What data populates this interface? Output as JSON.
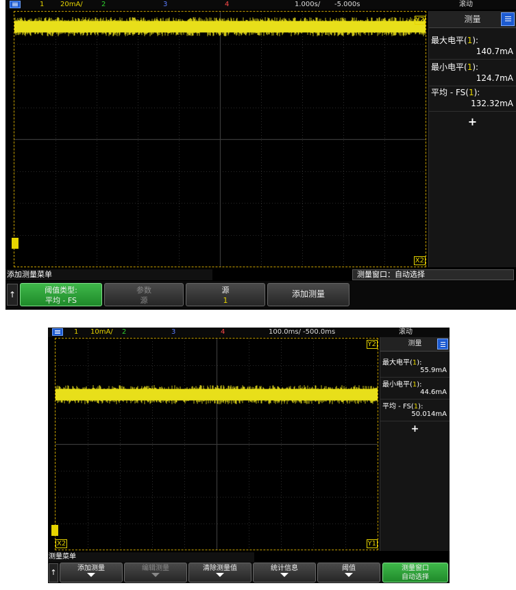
{
  "screen1": {
    "topbar": {
      "ch1": "1",
      "ch1_scale": "20mA/",
      "ch2": "2",
      "ch3": "3",
      "ch4": "4",
      "timebase": "1.000s/",
      "delay": "-5.000s",
      "mode": "滚动"
    },
    "markers": {
      "y2": "Y2",
      "x2": "X2"
    },
    "panel": {
      "title": "测量",
      "measurements": [
        {
          "name": "最大电平",
          "ch": "1",
          "value": "140.7mA"
        },
        {
          "name": "最小电平",
          "ch": "1",
          "value": "124.7mA"
        },
        {
          "name": "平均 - FS",
          "ch": "1",
          "value": "132.32mA"
        }
      ],
      "add": "+"
    },
    "menu_title": "添加测量菜单",
    "window_label": "测量窗口：自动选择",
    "softkeys": [
      {
        "line1": "阈值类型:",
        "line2": "平均 - FS"
      },
      {
        "line1": "参数",
        "line2": "源"
      },
      {
        "line1": "源",
        "line2": "1"
      },
      {
        "line1": "添加测量",
        "line2": ""
      }
    ]
  },
  "screen2": {
    "topbar": {
      "ch1": "1",
      "ch1_scale": "10mA/",
      "ch2": "2",
      "ch3": "3",
      "ch4": "4",
      "timebase": "100.0ms/",
      "delay": "-500.0ms",
      "mode": "滚动"
    },
    "markers": {
      "y2": "Y2",
      "x2": "X2",
      "y1": "Y1"
    },
    "panel": {
      "title": "测量",
      "measurements": [
        {
          "name": "最大电平",
          "ch": "1",
          "value": "55.9mA"
        },
        {
          "name": "最小电平",
          "ch": "1",
          "value": "44.6mA"
        },
        {
          "name": "平均 - FS",
          "ch": "1",
          "value": "50.014mA"
        }
      ],
      "add": "+"
    },
    "menu_title": "测量菜单",
    "softkeys": [
      {
        "line1": "添加测量"
      },
      {
        "line1": "编辑测量"
      },
      {
        "line1": "清除测量值"
      },
      {
        "line1": "统计信息"
      },
      {
        "line1": "阈值"
      },
      {
        "line1": "测量窗口",
        "line2": "自动选择"
      }
    ]
  },
  "colors": {
    "trace": "#e8df1a",
    "grid": "#3a3a3a",
    "accent_blue": "#1d5bd1",
    "softkey_green": "#2ea33a"
  }
}
